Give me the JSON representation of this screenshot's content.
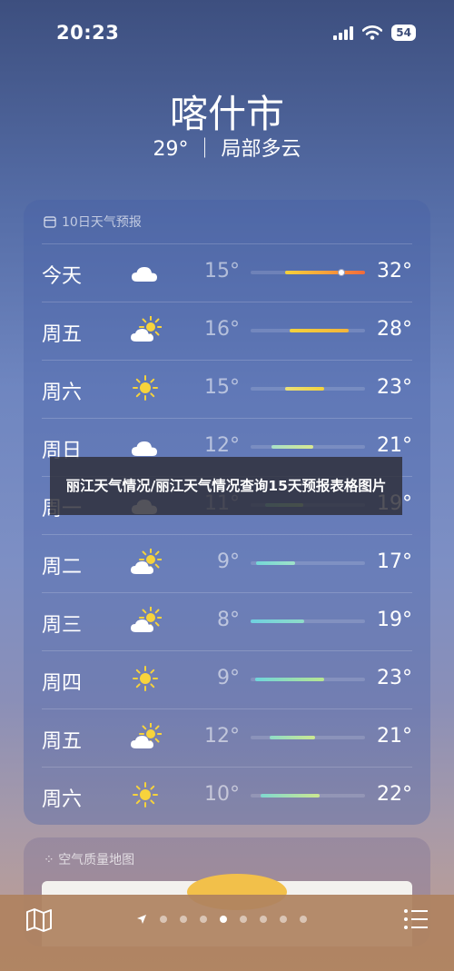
{
  "status": {
    "time": "20:23",
    "battery": "54"
  },
  "location": {
    "city": "喀什市",
    "condition": "29° ｜ 局部多云"
  },
  "forecast": {
    "header": "10日天气预报",
    "days": [
      {
        "day": "今天",
        "icon": "cloudy-icon",
        "low": "15°",
        "high": "32°",
        "bar_start": 0.3,
        "bar_end": 1.0,
        "bar_color": "linear-gradient(90deg,#f5d13a,#f7a23a,#f26a3a)"
      },
      {
        "day": "周五",
        "icon": "partly-cloudy-icon",
        "low": "16°",
        "high": "28°",
        "bar_start": 0.34,
        "bar_end": 0.86,
        "bar_color": "linear-gradient(90deg,#f3d23c,#f3b43b)"
      },
      {
        "day": "周六",
        "icon": "sunny-icon",
        "low": "15°",
        "high": "23°",
        "bar_start": 0.3,
        "bar_end": 0.64,
        "bar_color": "linear-gradient(90deg,#e9e07a,#f3d23c)"
      },
      {
        "day": "周日",
        "icon": "cloudy-icon",
        "low": "12°",
        "high": "21°",
        "bar_start": 0.18,
        "bar_end": 0.55,
        "bar_color": "linear-gradient(90deg,#a8e0c8,#d8e890)"
      },
      {
        "day": "周一",
        "icon": "cloudy-icon",
        "low": "11°",
        "high": "19°",
        "bar_start": 0.13,
        "bar_end": 0.46,
        "bar_color": "linear-gradient(90deg,#8edcc8,#b8e6a0)"
      },
      {
        "day": "周二",
        "icon": "partly-cloudy-icon",
        "low": "9°",
        "high": "17°",
        "bar_start": 0.05,
        "bar_end": 0.39,
        "bar_color": "linear-gradient(90deg,#74d7d8,#9fe2c8)"
      },
      {
        "day": "周三",
        "icon": "partly-cloudy-icon",
        "low": "8°",
        "high": "19°",
        "bar_start": 0.0,
        "bar_end": 0.47,
        "bar_color": "linear-gradient(90deg,#6fd0e0,#8edcc8)"
      },
      {
        "day": "周四",
        "icon": "sunny-icon",
        "low": "9°",
        "high": "23°",
        "bar_start": 0.04,
        "bar_end": 0.64,
        "bar_color": "linear-gradient(90deg,#6fd6dc,#b7e690)"
      },
      {
        "day": "周五",
        "icon": "partly-cloudy-icon",
        "low": "12°",
        "high": "21°",
        "bar_start": 0.17,
        "bar_end": 0.56,
        "bar_color": "linear-gradient(90deg,#8fdcc8,#cce890)"
      },
      {
        "day": "周六",
        "icon": "sunny-icon",
        "low": "10°",
        "high": "22°",
        "bar_start": 0.09,
        "bar_end": 0.6,
        "bar_color": "linear-gradient(90deg,#7fd9d0,#cce890)"
      }
    ]
  },
  "overlay": {
    "text": "丽江天气情况/丽江天气情况查询15天预报表格图片"
  },
  "air_quality": {
    "header": "空气质量地图"
  },
  "nav": {
    "page_count": 8,
    "active_page": 3
  }
}
